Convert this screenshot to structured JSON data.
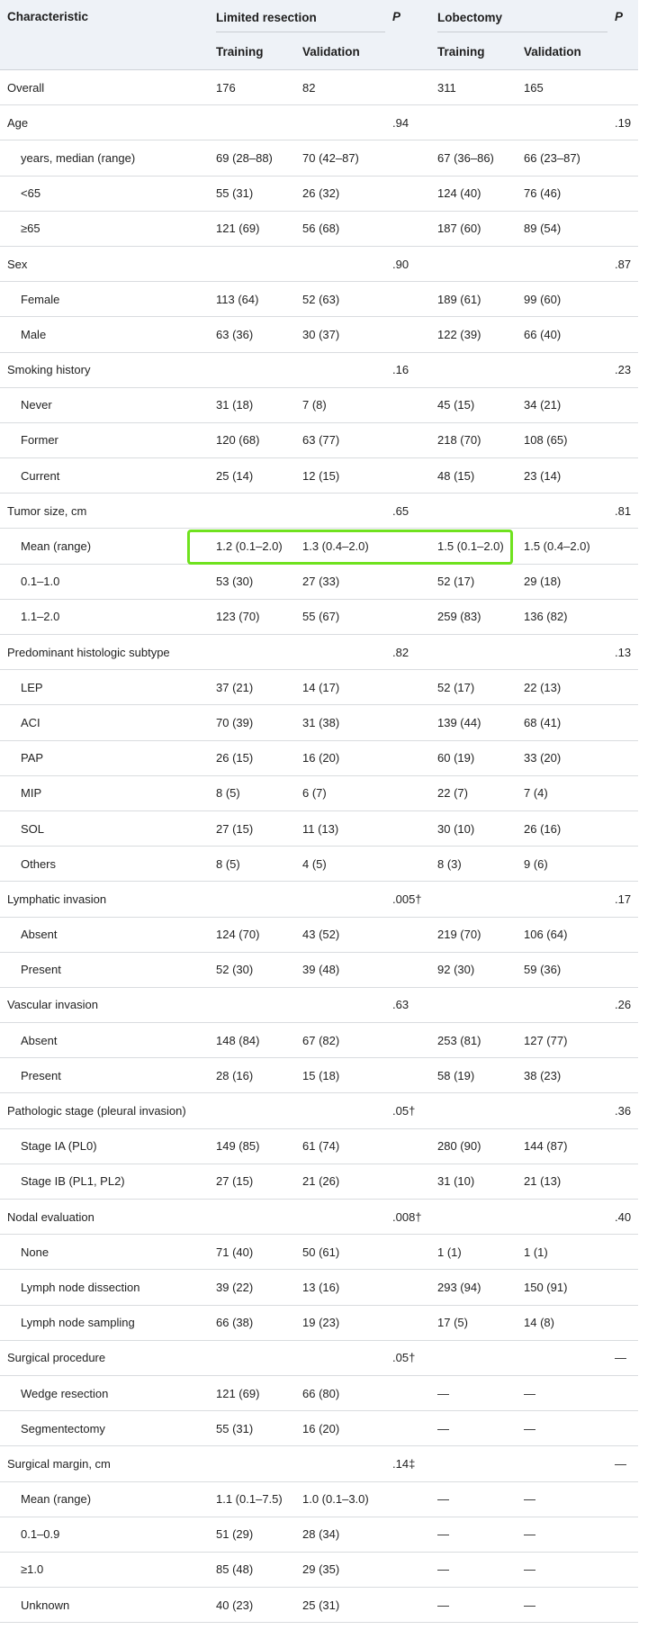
{
  "header": {
    "characteristic": "Characteristic",
    "limited_resection": "Limited resection",
    "lobectomy": "Lobectomy",
    "p": "P",
    "training": "Training",
    "validation": "Validation"
  },
  "rows": [
    {
      "label": "Overall",
      "indent": false,
      "lr_t": "176",
      "lr_v": "82",
      "p1": "",
      "lo_t": "311",
      "lo_v": "165",
      "p2": ""
    },
    {
      "label": "Age",
      "indent": false,
      "lr_t": "",
      "lr_v": "",
      "p1": ".94",
      "lo_t": "",
      "lo_v": "",
      "p2": ".19"
    },
    {
      "label": "years, median (range)",
      "indent": true,
      "lr_t": "69 (28–88)",
      "lr_v": "70 (42–87)",
      "p1": "",
      "lo_t": "67 (36–86)",
      "lo_v": "66 (23–87)",
      "p2": ""
    },
    {
      "label": "<65",
      "indent": true,
      "lr_t": "55 (31)",
      "lr_v": "26 (32)",
      "p1": "",
      "lo_t": "124 (40)",
      "lo_v": "76 (46)",
      "p2": ""
    },
    {
      "label": "≥65",
      "indent": true,
      "lr_t": "121 (69)",
      "lr_v": "56 (68)",
      "p1": "",
      "lo_t": "187 (60)",
      "lo_v": "89 (54)",
      "p2": ""
    },
    {
      "label": "Sex",
      "indent": false,
      "lr_t": "",
      "lr_v": "",
      "p1": ".90",
      "lo_t": "",
      "lo_v": "",
      "p2": ".87"
    },
    {
      "label": "Female",
      "indent": true,
      "lr_t": "113 (64)",
      "lr_v": "52 (63)",
      "p1": "",
      "lo_t": "189 (61)",
      "lo_v": "99 (60)",
      "p2": ""
    },
    {
      "label": "Male",
      "indent": true,
      "lr_t": "63 (36)",
      "lr_v": "30 (37)",
      "p1": "",
      "lo_t": "122 (39)",
      "lo_v": "66 (40)",
      "p2": ""
    },
    {
      "label": "Smoking history",
      "indent": false,
      "lr_t": "",
      "lr_v": "",
      "p1": ".16",
      "lo_t": "",
      "lo_v": "",
      "p2": ".23"
    },
    {
      "label": "Never",
      "indent": true,
      "lr_t": "31 (18)",
      "lr_v": "7 (8)",
      "p1": "",
      "lo_t": "45 (15)",
      "lo_v": "34 (21)",
      "p2": ""
    },
    {
      "label": "Former",
      "indent": true,
      "lr_t": "120 (68)",
      "lr_v": "63 (77)",
      "p1": "",
      "lo_t": "218 (70)",
      "lo_v": "108 (65)",
      "p2": ""
    },
    {
      "label": "Current",
      "indent": true,
      "lr_t": "25 (14)",
      "lr_v": "12 (15)",
      "p1": "",
      "lo_t": "48 (15)",
      "lo_v": "23 (14)",
      "p2": ""
    },
    {
      "label": "Tumor size, cm",
      "indent": false,
      "lr_t": "",
      "lr_v": "",
      "p1": ".65",
      "lo_t": "",
      "lo_v": "",
      "p2": ".81"
    },
    {
      "label": "Mean (range)",
      "indent": true,
      "lr_t": "1.2 (0.1–2.0)",
      "lr_v": "1.3 (0.4–2.0)",
      "p1": "",
      "lo_t": "1.5 (0.1–2.0)",
      "lo_v": "1.5 (0.4–2.0)",
      "p2": ""
    },
    {
      "label": "0.1–1.0",
      "indent": true,
      "lr_t": "53 (30)",
      "lr_v": "27 (33)",
      "p1": "",
      "lo_t": "52 (17)",
      "lo_v": "29 (18)",
      "p2": ""
    },
    {
      "label": "1.1–2.0",
      "indent": true,
      "lr_t": "123 (70)",
      "lr_v": "55 (67)",
      "p1": "",
      "lo_t": "259 (83)",
      "lo_v": "136 (82)",
      "p2": ""
    },
    {
      "label": "Predominant histologic subtype",
      "indent": false,
      "lr_t": "",
      "lr_v": "",
      "p1": ".82",
      "lo_t": "",
      "lo_v": "",
      "p2": ".13"
    },
    {
      "label": "LEP",
      "indent": true,
      "lr_t": "37 (21)",
      "lr_v": "14 (17)",
      "p1": "",
      "lo_t": "52 (17)",
      "lo_v": "22 (13)",
      "p2": ""
    },
    {
      "label": "ACI",
      "indent": true,
      "lr_t": "70 (39)",
      "lr_v": "31 (38)",
      "p1": "",
      "lo_t": "139 (44)",
      "lo_v": "68 (41)",
      "p2": ""
    },
    {
      "label": "PAP",
      "indent": true,
      "lr_t": "26 (15)",
      "lr_v": "16 (20)",
      "p1": "",
      "lo_t": "60 (19)",
      "lo_v": "33 (20)",
      "p2": ""
    },
    {
      "label": "MIP",
      "indent": true,
      "lr_t": "8 (5)",
      "lr_v": "6 (7)",
      "p1": "",
      "lo_t": "22 (7)",
      "lo_v": "7 (4)",
      "p2": ""
    },
    {
      "label": "SOL",
      "indent": true,
      "lr_t": "27 (15)",
      "lr_v": "11 (13)",
      "p1": "",
      "lo_t": "30 (10)",
      "lo_v": "26 (16)",
      "p2": ""
    },
    {
      "label": "Others",
      "indent": true,
      "lr_t": "8 (5)",
      "lr_v": "4 (5)",
      "p1": "",
      "lo_t": "8 (3)",
      "lo_v": "9 (6)",
      "p2": ""
    },
    {
      "label": "Lymphatic invasion",
      "indent": false,
      "lr_t": "",
      "lr_v": "",
      "p1": ".005†",
      "lo_t": "",
      "lo_v": "",
      "p2": ".17"
    },
    {
      "label": "Absent",
      "indent": true,
      "lr_t": "124 (70)",
      "lr_v": "43 (52)",
      "p1": "",
      "lo_t": "219 (70)",
      "lo_v": "106 (64)",
      "p2": ""
    },
    {
      "label": "Present",
      "indent": true,
      "lr_t": "52 (30)",
      "lr_v": "39 (48)",
      "p1": "",
      "lo_t": "92 (30)",
      "lo_v": "59 (36)",
      "p2": ""
    },
    {
      "label": "Vascular invasion",
      "indent": false,
      "lr_t": "",
      "lr_v": "",
      "p1": ".63",
      "lo_t": "",
      "lo_v": "",
      "p2": ".26"
    },
    {
      "label": "Absent",
      "indent": true,
      "lr_t": "148 (84)",
      "lr_v": "67 (82)",
      "p1": "",
      "lo_t": "253 (81)",
      "lo_v": "127 (77)",
      "p2": ""
    },
    {
      "label": "Present",
      "indent": true,
      "lr_t": "28 (16)",
      "lr_v": "15 (18)",
      "p1": "",
      "lo_t": "58 (19)",
      "lo_v": "38 (23)",
      "p2": ""
    },
    {
      "label": "Pathologic stage (pleural invasion)",
      "indent": false,
      "lr_t": "",
      "lr_v": "",
      "p1": ".05†",
      "lo_t": "",
      "lo_v": "",
      "p2": ".36"
    },
    {
      "label": "Stage IA (PL0)",
      "indent": true,
      "lr_t": "149 (85)",
      "lr_v": "61 (74)",
      "p1": "",
      "lo_t": "280 (90)",
      "lo_v": "144 (87)",
      "p2": ""
    },
    {
      "label": "Stage IB (PL1, PL2)",
      "indent": true,
      "lr_t": "27 (15)",
      "lr_v": "21 (26)",
      "p1": "",
      "lo_t": "31 (10)",
      "lo_v": "21 (13)",
      "p2": ""
    },
    {
      "label": "Nodal evaluation",
      "indent": false,
      "lr_t": "",
      "lr_v": "",
      "p1": ".008†",
      "lo_t": "",
      "lo_v": "",
      "p2": ".40"
    },
    {
      "label": "None",
      "indent": true,
      "lr_t": "71 (40)",
      "lr_v": "50 (61)",
      "p1": "",
      "lo_t": "1 (1)",
      "lo_v": "1 (1)",
      "p2": ""
    },
    {
      "label": "Lymph node dissection",
      "indent": true,
      "lr_t": "39 (22)",
      "lr_v": "13 (16)",
      "p1": "",
      "lo_t": "293 (94)",
      "lo_v": "150 (91)",
      "p2": ""
    },
    {
      "label": "Lymph node sampling",
      "indent": true,
      "lr_t": "66 (38)",
      "lr_v": "19 (23)",
      "p1": "",
      "lo_t": "17 (5)",
      "lo_v": "14 (8)",
      "p2": ""
    },
    {
      "label": "Surgical procedure",
      "indent": false,
      "lr_t": "",
      "lr_v": "",
      "p1": ".05†",
      "lo_t": "",
      "lo_v": "",
      "p2": "—"
    },
    {
      "label": "Wedge resection",
      "indent": true,
      "lr_t": "121 (69)",
      "lr_v": "66 (80)",
      "p1": "",
      "lo_t": "—",
      "lo_v": "—",
      "p2": ""
    },
    {
      "label": "Segmentectomy",
      "indent": true,
      "lr_t": "55 (31)",
      "lr_v": "16 (20)",
      "p1": "",
      "lo_t": "—",
      "lo_v": "—",
      "p2": ""
    },
    {
      "label": "Surgical margin, cm",
      "indent": false,
      "lr_t": "",
      "lr_v": "",
      "p1": ".14‡",
      "lo_t": "",
      "lo_v": "",
      "p2": "—"
    },
    {
      "label": "Mean (range)",
      "indent": true,
      "lr_t": "1.1 (0.1–7.5)",
      "lr_v": "1.0 (0.1–3.0)",
      "p1": "",
      "lo_t": "—",
      "lo_v": "—",
      "p2": ""
    },
    {
      "label": "0.1–0.9",
      "indent": true,
      "lr_t": "51 (29)",
      "lr_v": "28 (34)",
      "p1": "",
      "lo_t": "—",
      "lo_v": "—",
      "p2": ""
    },
    {
      "label": "≥1.0",
      "indent": true,
      "lr_t": "85 (48)",
      "lr_v": "29 (35)",
      "p1": "",
      "lo_t": "—",
      "lo_v": "—",
      "p2": ""
    },
    {
      "label": "Unknown",
      "indent": true,
      "lr_t": "40 (23)",
      "lr_v": "25 (31)",
      "p1": "",
      "lo_t": "—",
      "lo_v": "—",
      "p2": ""
    }
  ],
  "highlight": {
    "color": "#6fe21e"
  }
}
